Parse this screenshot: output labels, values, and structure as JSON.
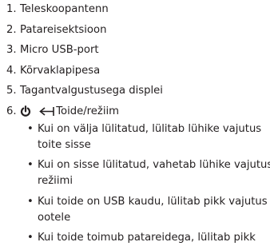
{
  "list": [
    {
      "number": "1.",
      "text": "Teleskoopantenn"
    },
    {
      "number": "2.",
      "text": "Patareisektsioon"
    },
    {
      "number": "3.",
      "text": "Micro USB-port"
    },
    {
      "number": "4.",
      "text": "Kõrvaklapipesa"
    },
    {
      "number": "5.",
      "text": "Tagantvalgustusega displei"
    },
    {
      "number": "6.",
      "text": "Toide/režiim",
      "icons": [
        "power-icon",
        "mode-arrow-icon"
      ]
    }
  ],
  "sub_items": [
    {
      "bullet": "•",
      "text": "Kui on välja lülitatud, lülitab lühike vajutus toite sisse"
    },
    {
      "bullet": "•",
      "text": "Kui on sisse lülitatud, vahetab lühike vajutus režiimi"
    },
    {
      "bullet": "•",
      "text": "Kui toide on USB kaudu, lülitab pikk vajutus ootele"
    },
    {
      "bullet": "•",
      "text": "Kui toide toimub patareidega, lülitab pikk"
    }
  ]
}
